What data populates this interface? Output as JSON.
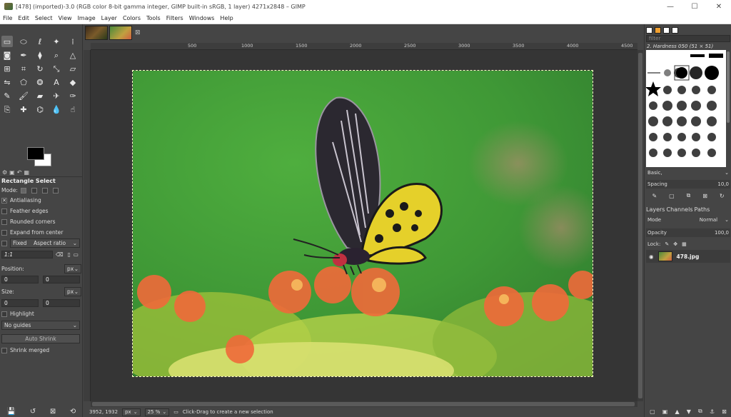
{
  "titlebar": {
    "title": "[478] (imported)-3.0 (RGB color 8-bit gamma integer, GIMP built-in sRGB, 1 layer) 4271x2848 – GIMP",
    "minimize": "—",
    "maximize": "☐",
    "close": "✕"
  },
  "menu": [
    "File",
    "Edit",
    "Select",
    "View",
    "Image",
    "Layer",
    "Colors",
    "Tools",
    "Filters",
    "Windows",
    "Help"
  ],
  "toolbox": {
    "tools": [
      {
        "name": "rect-select-tool-icon",
        "glyph": "▭"
      },
      {
        "name": "ellipse-select-tool-icon",
        "glyph": "⬭"
      },
      {
        "name": "free-select-tool-icon",
        "glyph": "ℓ"
      },
      {
        "name": "fuzzy-select-tool-icon",
        "glyph": "✦"
      },
      {
        "name": "select-by-color-tool-icon",
        "glyph": "⁞"
      },
      {
        "name": "scissors-tool-icon",
        "glyph": "✂"
      },
      {
        "name": "foreground-select-tool-icon",
        "glyph": "◙"
      },
      {
        "name": "paths-tool-icon",
        "glyph": "✒"
      },
      {
        "name": "color-picker-tool-icon",
        "glyph": "⧫"
      },
      {
        "name": "zoom-tool-icon",
        "glyph": "⌕"
      },
      {
        "name": "measure-tool-icon",
        "glyph": "△"
      },
      {
        "name": "move-tool-icon",
        "glyph": "✥"
      },
      {
        "name": "align-tool-icon",
        "glyph": "⊞"
      },
      {
        "name": "crop-tool-icon",
        "glyph": "⌗"
      },
      {
        "name": "rotate-tool-icon",
        "glyph": "↻"
      },
      {
        "name": "scale-tool-icon",
        "glyph": "⤡"
      },
      {
        "name": "shear-tool-icon",
        "glyph": "▱"
      },
      {
        "name": "perspective-tool-icon",
        "glyph": "⏢"
      },
      {
        "name": "flip-tool-icon",
        "glyph": "⇋"
      },
      {
        "name": "cage-tool-icon",
        "glyph": "⬠"
      },
      {
        "name": "warp-tool-icon",
        "glyph": "❂"
      },
      {
        "name": "text-tool-icon",
        "glyph": "A"
      },
      {
        "name": "bucket-fill-tool-icon",
        "glyph": "◆"
      },
      {
        "name": "blend-tool-icon",
        "glyph": "▤"
      },
      {
        "name": "pencil-tool-icon",
        "glyph": "✎"
      },
      {
        "name": "paintbrush-tool-icon",
        "glyph": "🖌"
      },
      {
        "name": "eraser-tool-icon",
        "glyph": "▰"
      },
      {
        "name": "airbrush-tool-icon",
        "glyph": "✈"
      },
      {
        "name": "ink-tool-icon",
        "glyph": "✑"
      },
      {
        "name": "mypaint-brush-tool-icon",
        "glyph": "⚘"
      },
      {
        "name": "clone-tool-icon",
        "glyph": "⎘"
      },
      {
        "name": "heal-tool-icon",
        "glyph": "✚"
      },
      {
        "name": "perspective-clone-tool-icon",
        "glyph": "⌬"
      },
      {
        "name": "blur-tool-icon",
        "glyph": "💧"
      },
      {
        "name": "smudge-tool-icon",
        "glyph": "☝"
      },
      {
        "name": "dodge-burn-tool-icon",
        "glyph": "⚲"
      }
    ]
  },
  "tool_options": {
    "title": "Rectangle Select",
    "mode_label": "Mode:",
    "antialiasing": "Antialiasing",
    "feather": "Feather edges",
    "rounded": "Rounded corners",
    "expand": "Expand from center",
    "fixed": "Fixed",
    "fixed_value": "Aspect ratio",
    "ratio": "1:1",
    "position_label": "Position:",
    "size_label": "Size:",
    "unit": "px",
    "pos_x": "0",
    "pos_y": "0",
    "size_w": "0",
    "size_h": "0",
    "highlight": "Highlight",
    "guides": "No guides",
    "auto_shrink": "Auto Shrink",
    "shrink_merged": "Shrink merged",
    "check_mark": "✕"
  },
  "ruler_labels": [
    "500",
    "1000",
    "1500",
    "2000",
    "2500",
    "3000",
    "3500",
    "4000",
    "4500"
  ],
  "status": {
    "coords": "3952, 1932",
    "unit": "px",
    "zoom": "25 %",
    "message": "Click-Drag to create a new selection"
  },
  "brushes": {
    "filter_placeholder": "filter",
    "current": "2. Hardness 050 (51 × 51)",
    "preset": "Basic,",
    "spacing_label": "Spacing",
    "spacing_value": "10,0"
  },
  "layers": {
    "tabs": [
      "Layers",
      "Channels",
      "Paths"
    ],
    "mode_label": "Mode",
    "mode_value": "Normal",
    "opacity_label": "Opacity",
    "opacity_value": "100,0",
    "lock_label": "Lock:",
    "layer_name": "478.jpg"
  }
}
